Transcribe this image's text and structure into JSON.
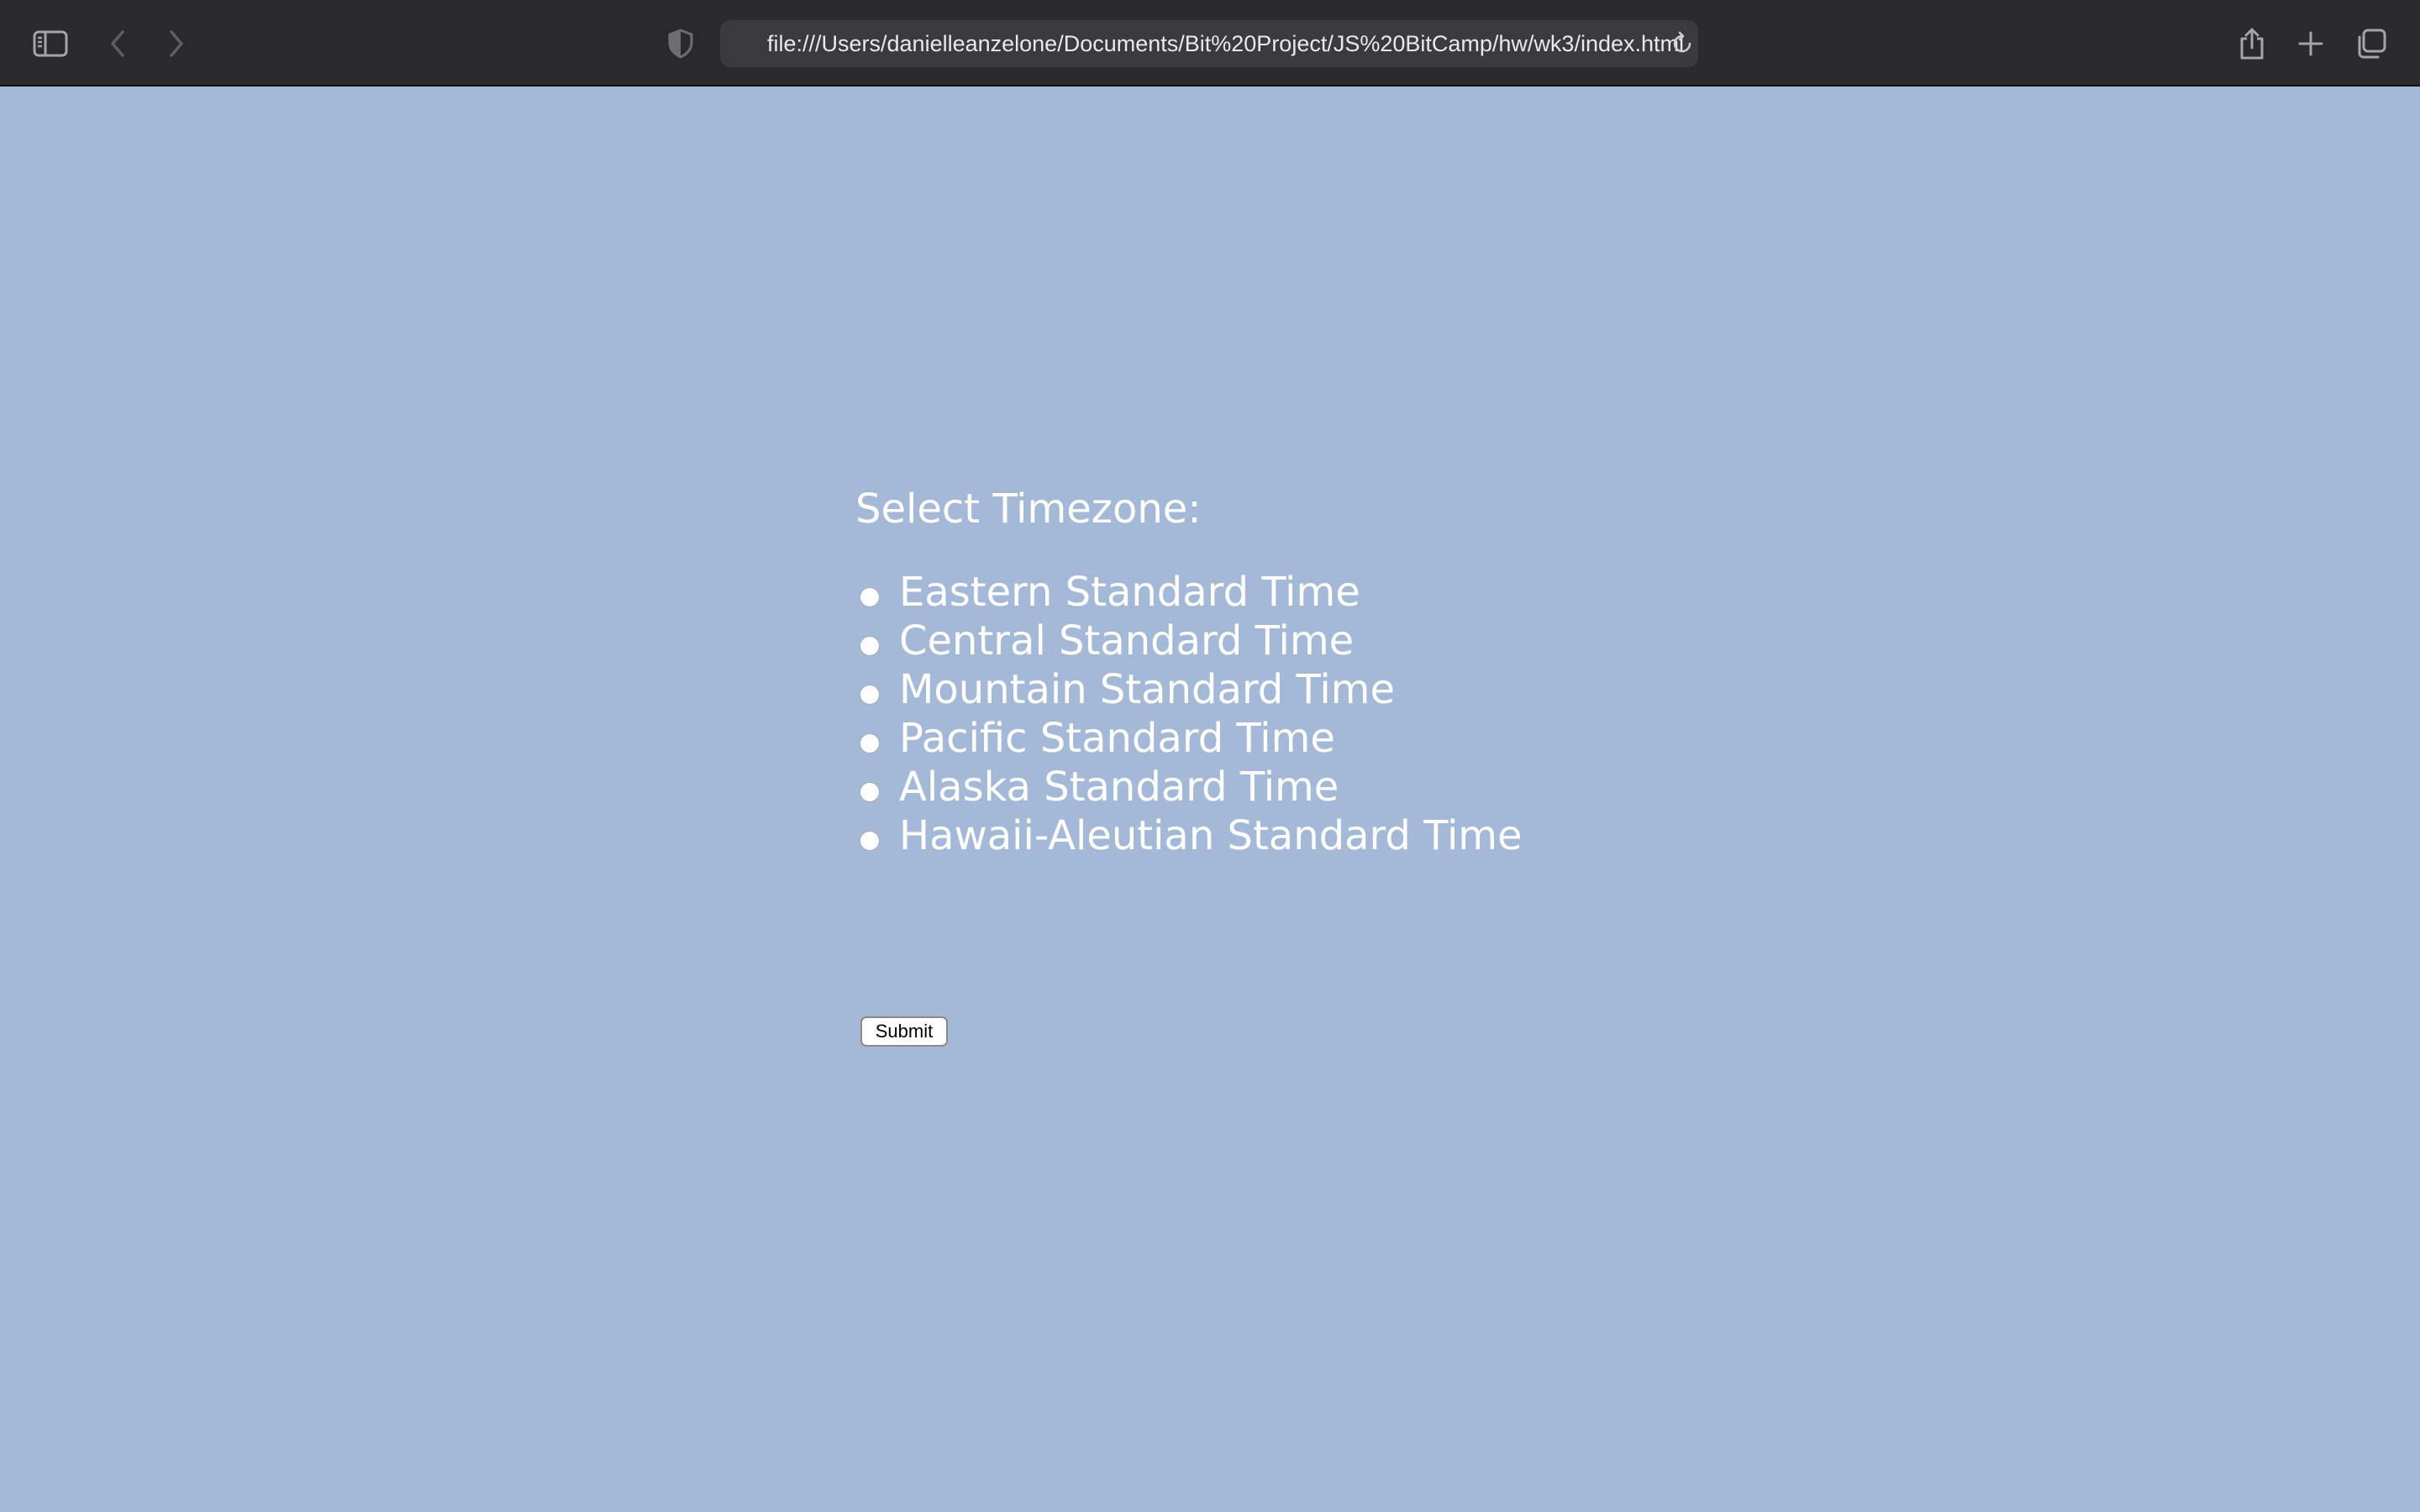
{
  "browser": {
    "url": "file:///Users/danielleanzelone/Documents/Bit%20Project/JS%20BitCamp/hw/wk3/index.html",
    "toolbar_icons": {
      "sidebar": "sidebar-icon",
      "back": "chevron-left-icon",
      "forward": "chevron-right-icon",
      "privacy": "shield-icon",
      "reload": "reload-icon",
      "share": "share-icon",
      "new_tab": "plus-icon",
      "tab_overview": "tabs-icon"
    }
  },
  "page": {
    "background_color": "#a4b8d8",
    "form": {
      "title": "Select Timezone:",
      "options": [
        {
          "label": "Eastern Standard Time"
        },
        {
          "label": "Central Standard Time"
        },
        {
          "label": "Mountain Standard Time"
        },
        {
          "label": "Pacific Standard Time"
        },
        {
          "label": "Alaska Standard Time"
        },
        {
          "label": "Hawaii-Aleutian Standard Time"
        }
      ],
      "submit_label": "Submit"
    }
  }
}
